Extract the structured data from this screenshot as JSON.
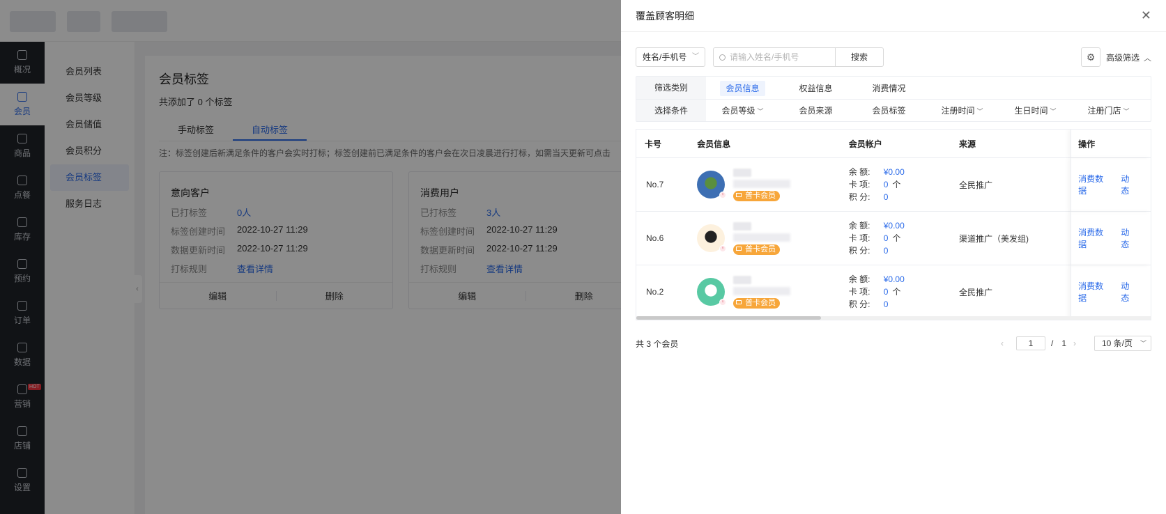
{
  "left_nav": {
    "items": [
      {
        "label": "概况",
        "icon": "dashboard-icon"
      },
      {
        "label": "会员",
        "icon": "crown-icon",
        "active": true
      },
      {
        "label": "商品",
        "icon": "box-icon"
      },
      {
        "label": "点餐",
        "icon": "cloche-icon"
      },
      {
        "label": "库存",
        "icon": "warehouse-icon"
      },
      {
        "label": "预约",
        "icon": "calendar-check-icon"
      },
      {
        "label": "订单",
        "icon": "clipboard-icon"
      },
      {
        "label": "数据",
        "icon": "chart-icon"
      },
      {
        "label": "营销",
        "icon": "shop-bag-icon",
        "badge": "HOT"
      },
      {
        "label": "店铺",
        "icon": "store-icon"
      },
      {
        "label": "设置",
        "icon": "gear-icon"
      }
    ]
  },
  "sub_nav": {
    "items": [
      "会员列表",
      "会员等级",
      "会员储值",
      "会员积分",
      "会员标签",
      "服务日志"
    ],
    "active_index": 4
  },
  "page": {
    "title": "会员标签",
    "tag_count": "共添加了 0 个标签",
    "tabs": [
      "手动标签",
      "自动标签"
    ],
    "active_tab": 1,
    "note": "注：标签创建后新满足条件的客户会实时打标；标签创建前已满足条件的客户会在次日凌晨进行打标，如需当天更新可点击",
    "cards": [
      {
        "title": "意向客户",
        "rows": [
          {
            "k": "已打标签",
            "v": "0人",
            "link": true
          },
          {
            "k": "标签创建时间",
            "v": "2022-10-27 11:29"
          },
          {
            "k": "数据更新时间",
            "v": "2022-10-27 11:29"
          },
          {
            "k": "打标规则",
            "v": "查看详情",
            "link": true
          }
        ],
        "edit": "编辑",
        "delete": "删除"
      },
      {
        "title": "消费用户",
        "rows": [
          {
            "k": "已打标签",
            "v": "3人",
            "link": true
          },
          {
            "k": "标签创建时间",
            "v": "2022-10-27 11:29"
          },
          {
            "k": "数据更新时间",
            "v": "2022-10-27 11:29"
          },
          {
            "k": "打标规则",
            "v": "查看详情",
            "link": true
          }
        ],
        "edit": "编辑",
        "delete": "删除"
      }
    ]
  },
  "drawer": {
    "title": "覆盖顾客明细",
    "close_glyph": "✕",
    "search": {
      "field_select": "姓名/手机号",
      "placeholder": "请输入姓名/手机号",
      "button": "搜索"
    },
    "advanced_filter": "高级筛选",
    "filter": {
      "category_label": "筛选类别",
      "categories": [
        "会员信息",
        "权益信息",
        "消费情况"
      ],
      "active_category": 0,
      "condition_label": "选择条件",
      "conditions": [
        {
          "label": "会员等级",
          "dropdown": true
        },
        {
          "label": "会员来源",
          "dropdown": false
        },
        {
          "label": "会员标签",
          "dropdown": false
        },
        {
          "label": "注册时间",
          "dropdown": true
        },
        {
          "label": "生日时间",
          "dropdown": true
        },
        {
          "label": "注册门店",
          "dropdown": true
        }
      ]
    },
    "table": {
      "headers": [
        "卡号",
        "会员信息",
        "会员帐户",
        "来源",
        "操作"
      ],
      "account_labels": {
        "balance": "余 额:",
        "items": "卡 项:",
        "points": "积 分:"
      },
      "actions": [
        "消费数据",
        "动态"
      ],
      "rows": [
        {
          "card_no": "No.7",
          "badge": "普卡会员",
          "balance": "¥0.00",
          "items": "0",
          "items_unit": "个",
          "points": "0",
          "source": "全民推广",
          "avatar_colors": [
            "#3d6fb3",
            "#5a8f3e"
          ]
        },
        {
          "card_no": "No.6",
          "badge": "普卡会员",
          "balance": "¥0.00",
          "items": "0",
          "items_unit": "个",
          "points": "0",
          "source": "渠道推广（美发组)",
          "avatar_colors": [
            "#fdf1de",
            "#222222"
          ]
        },
        {
          "card_no": "No.2",
          "badge": "普卡会员",
          "balance": "¥0.00",
          "items": "0",
          "items_unit": "个",
          "points": "0",
          "source": "全民推广",
          "avatar_colors": [
            "#58c9a3",
            "#ffffff"
          ]
        }
      ]
    },
    "pagination": {
      "total": "共 3 个会员",
      "current": "1",
      "separator": "/",
      "pages": "1",
      "page_size": "10 条/页"
    }
  },
  "colors": {
    "accent": "#2a6ae9",
    "badge": "#f7a63a",
    "nav_bg": "#1f2329"
  }
}
